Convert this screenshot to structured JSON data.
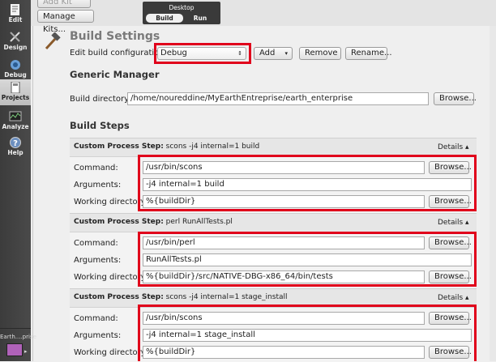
{
  "modes": [
    {
      "label": "Edit",
      "icon": "edit-icon"
    },
    {
      "label": "Design",
      "icon": "design-icon"
    },
    {
      "label": "Debug",
      "icon": "debug-icon"
    },
    {
      "label": "Projects",
      "icon": "projects-icon"
    },
    {
      "label": "Analyze",
      "icon": "analyze-icon"
    },
    {
      "label": "Help",
      "icon": "help-icon"
    }
  ],
  "kit": {
    "label": "Earth....prise"
  },
  "topbar": {
    "add_kit": "Add Kit",
    "manage_kits": "Manage Kits...",
    "target": "Desktop",
    "build_tab": "Build",
    "run_tab": "Run"
  },
  "build_settings": {
    "title": "Build Settings",
    "config_label": "Edit build configuration:",
    "config_value": "Debug",
    "add": "Add",
    "remove": "Remove",
    "rename": "Rename..."
  },
  "manager": {
    "title": "Generic Manager",
    "dir_label": "Build directory:",
    "dir_value": "/home/noureddine/MyEarthEntreprise/earth_enterprise",
    "browse": "Browse..."
  },
  "steps_title": "Build Steps",
  "steps": [
    {
      "head_bold": "Custom Process Step:",
      "head_rest": " scons -j4 internal=1 build",
      "details": "Details ▴",
      "command_label": "Command:",
      "command": "/usr/bin/scons",
      "args_label": "Arguments:",
      "args": "-j4 internal=1 build",
      "wd_label": "Working directory:",
      "wd": "%{buildDir}",
      "browse": "Browse..."
    },
    {
      "head_bold": "Custom Process Step:",
      "head_rest": " perl RunAllTests.pl",
      "details": "Details ▴",
      "command_label": "Command:",
      "command": "/usr/bin/perl",
      "args_label": "Arguments:",
      "args": "RunAllTests.pl",
      "wd_label": "Working directory:",
      "wd": "%{buildDir}/src/NATIVE-DBG-x86_64/bin/tests",
      "browse": "Browse..."
    },
    {
      "head_bold": "Custom Process Step:",
      "head_rest": " scons -j4 internal=1 stage_install",
      "details": "Details ▴",
      "command_label": "Command:",
      "command": "/usr/bin/scons",
      "args_label": "Arguments:",
      "args": "-j4 internal=1 stage_install",
      "wd_label": "Working directory:",
      "wd": "%{buildDir}",
      "browse": "Browse..."
    }
  ],
  "colors": {
    "highlight": "#e0001b",
    "modebar": "#3c3c3c"
  }
}
